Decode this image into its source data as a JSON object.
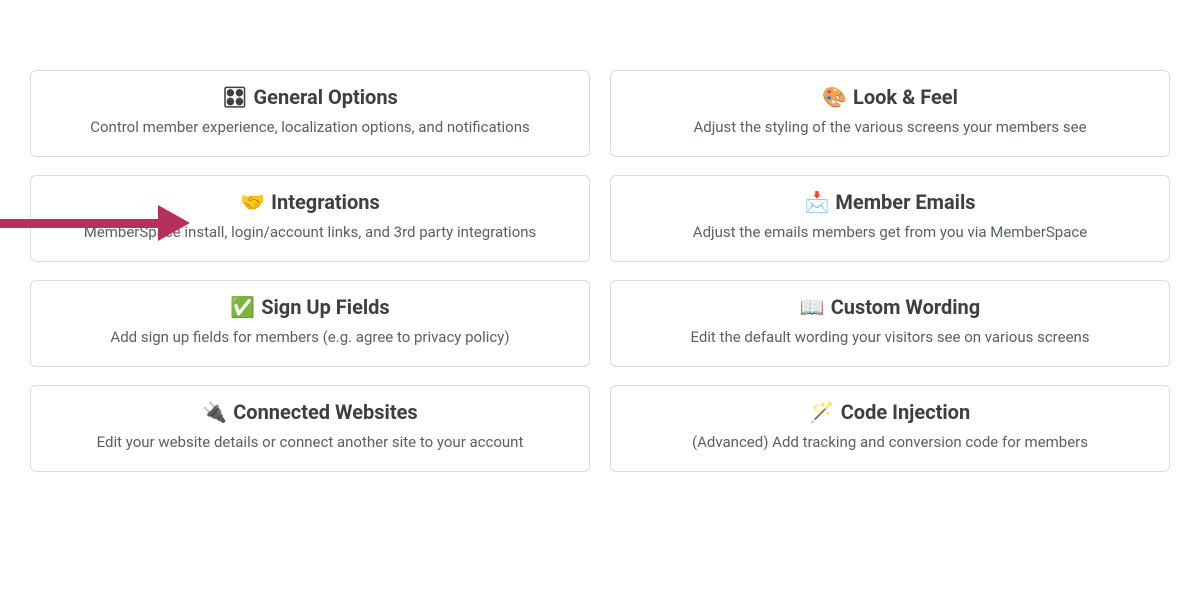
{
  "cards": [
    {
      "icon": "🎛",
      "title": "General Options",
      "desc": "Control member experience, localization options, and notifications"
    },
    {
      "icon": "🎨",
      "title": "Look & Feel",
      "desc": "Adjust the styling of the various screens your members see"
    },
    {
      "icon": "🤝",
      "title": "Integrations",
      "desc": "MemberSpace install, login/account links, and 3rd party integrations"
    },
    {
      "icon": "📩",
      "title": "Member Emails",
      "desc": "Adjust the emails members get from you via MemberSpace"
    },
    {
      "icon": "✅",
      "title": "Sign Up Fields",
      "desc": "Add sign up fields for members (e.g. agree to privacy policy)"
    },
    {
      "icon": "📖",
      "title": "Custom Wording",
      "desc": "Edit the default wording your visitors see on various screens"
    },
    {
      "icon": "🔌",
      "title": "Connected Websites",
      "desc": "Edit your website details or connect another site to your account"
    },
    {
      "icon": "🪄",
      "title": "Code Injection",
      "desc": "(Advanced) Add tracking and conversion code for members"
    }
  ]
}
